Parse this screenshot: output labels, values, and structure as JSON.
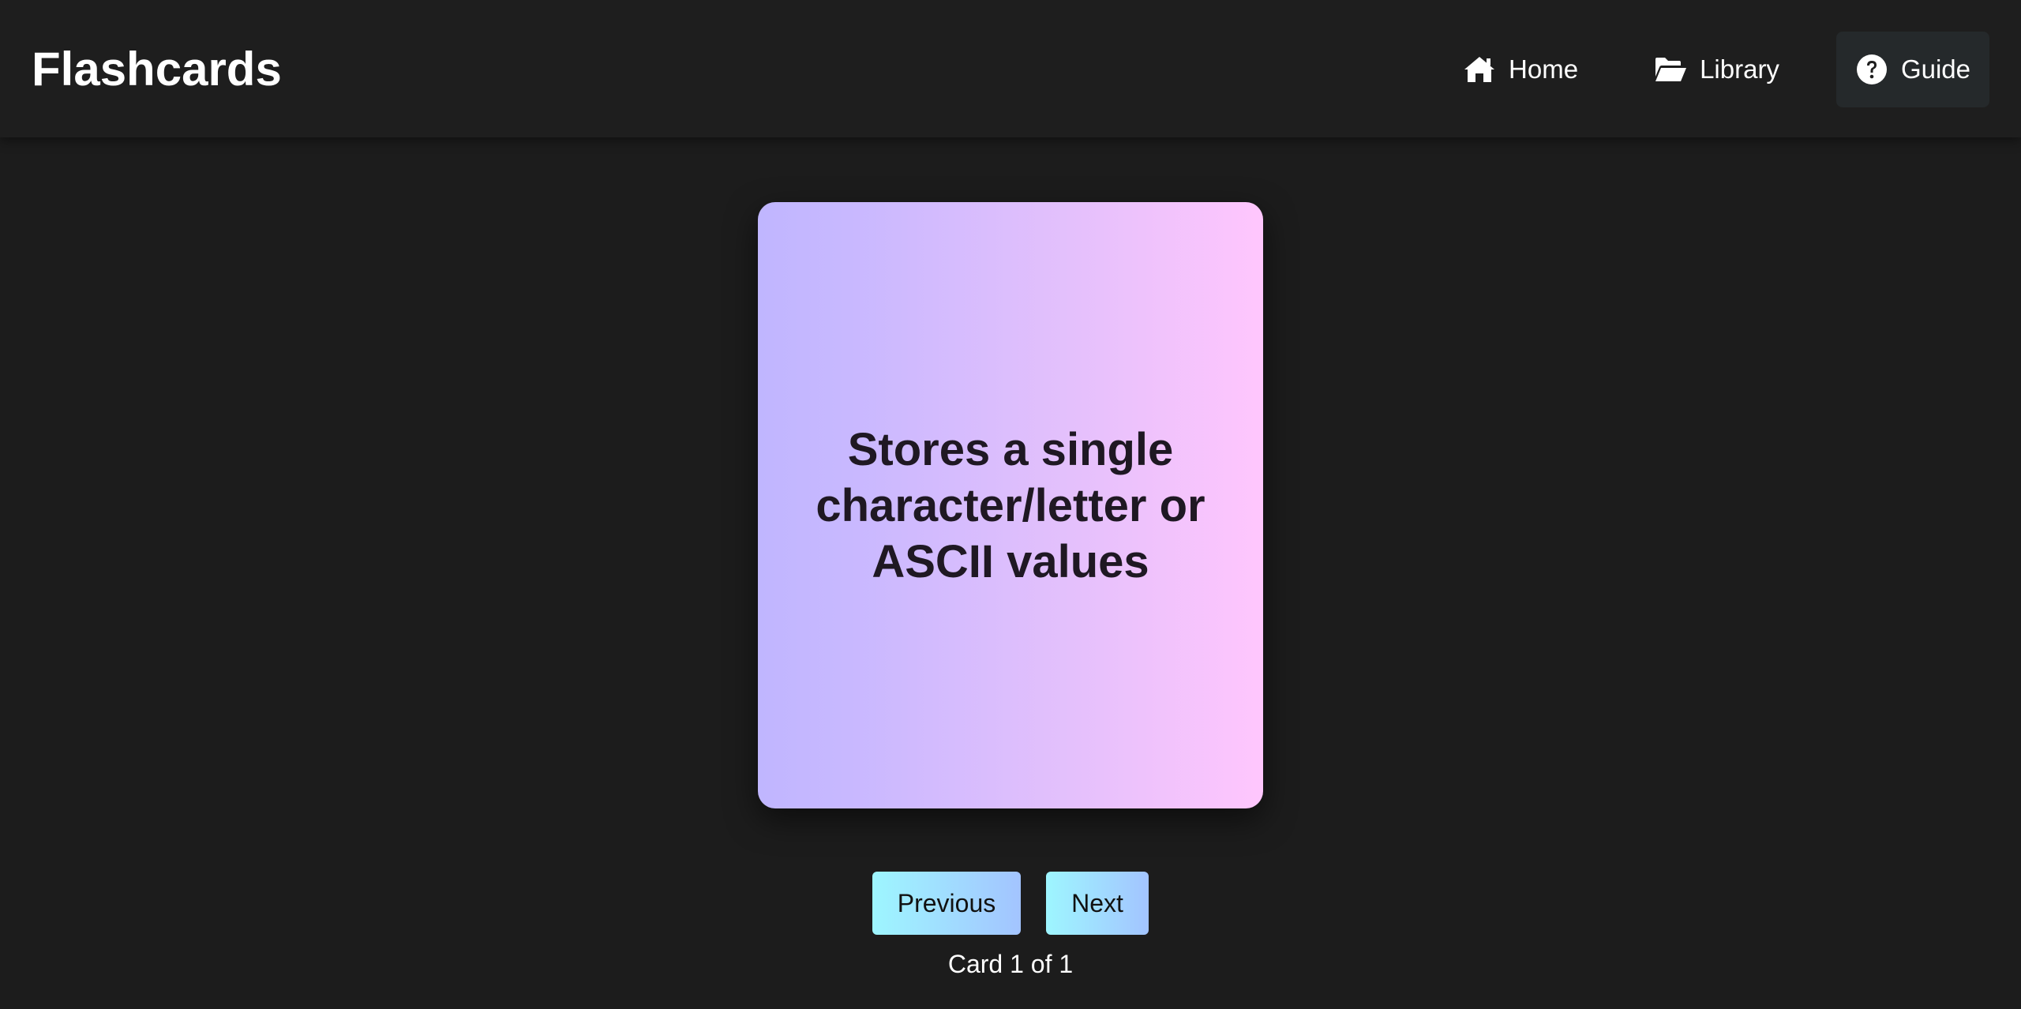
{
  "app": {
    "title": "Flashcards"
  },
  "nav": {
    "items": [
      {
        "label": "Home",
        "icon": "home-icon",
        "active": false
      },
      {
        "label": "Library",
        "icon": "folder-open-icon",
        "active": false
      },
      {
        "label": "Guide",
        "icon": "question-circle-icon",
        "active": true
      }
    ]
  },
  "card": {
    "text": "Stores a single character/letter or ASCII values"
  },
  "controls": {
    "previous_label": "Previous",
    "next_label": "Next",
    "counter": "Card 1 of 1"
  },
  "colors": {
    "background": "#1c1c1c",
    "card_gradient_start": "#c0b6ff",
    "card_gradient_end": "#ffc6fd",
    "button_gradient_start": "#9ef6ff",
    "button_gradient_end": "#a3c4ff",
    "active_nav_bg": "#25292b"
  }
}
